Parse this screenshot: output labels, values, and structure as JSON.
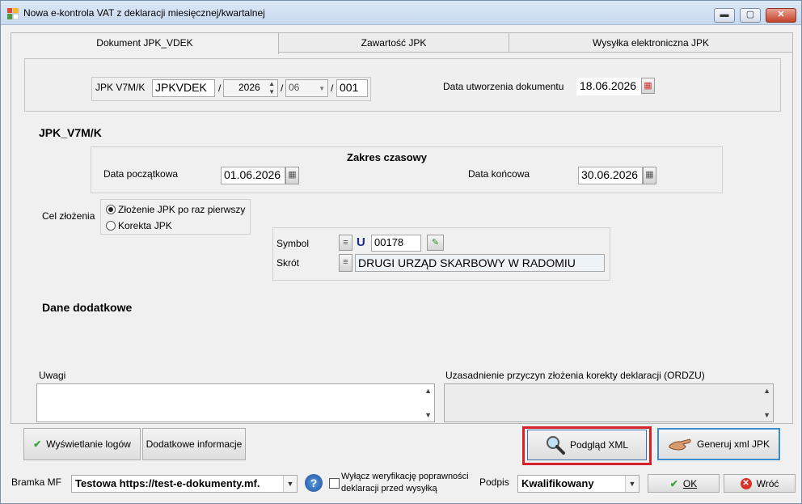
{
  "window": {
    "title": "Nowa e-kontrola VAT z deklaracji miesięcznej/kwartalnej",
    "minimize": "▬",
    "maximize": "▢",
    "close": "✕"
  },
  "tabs": [
    "Dokument JPK_VDEK",
    "Zawartość JPK",
    "Wysyłka elektroniczna JPK"
  ],
  "header": {
    "jpk_label": "JPK V7M/K",
    "jpk_code": "JPKVDEK",
    "sep": "/",
    "year": "2026",
    "month": "06",
    "number": "001",
    "created_label": "Data utworzenia dokumentu",
    "created_date": "18.06.2026"
  },
  "section_title": "JPK_V7M/K",
  "range": {
    "title": "Zakres czasowy",
    "start_label": "Data początkowa",
    "start_date": "01.06.2026",
    "end_label": "Data końcowa",
    "end_date": "30.06.2026"
  },
  "purpose": {
    "label": "Cel złożenia",
    "options": [
      "Złożenie JPK po raz pierwszy",
      "Korekta JPK"
    ],
    "selected": 0
  },
  "office": {
    "symbol_label": "Symbol",
    "u_letter": "U",
    "symbol": "00178",
    "short_label": "Skrót",
    "short": "DRUGI URZĄD SKARBOWY W RADOMIU"
  },
  "extra_title": "Dane dodatkowe",
  "notes_label": "Uwagi",
  "ordzu_label": "Uzasadnienie przyczyn złożenia korekty deklaracji (ORDZU)",
  "buttons": {
    "logs": "Wyświetlanie logów",
    "extra_info": "Dodatkowe informacje",
    "preview": "Podgląd XML",
    "generate": "Generuj xml JPK",
    "ok": "OK",
    "back": "Wróć"
  },
  "footer": {
    "gate_label": "Bramka MF",
    "gate_value": "Testowa https://test-e-dokumenty.mf.",
    "verify_line1": "Wyłącz weryfikację poprawności",
    "verify_line2": "deklaracji przed wysyłką",
    "sign_label": "Podpis",
    "sign_value": "Kwalifikowany"
  },
  "colors": {
    "highlight": "#d6202a",
    "ok_check": "#3aa63a",
    "close_red": "#c3422c",
    "u_blue": "#1a2c8a"
  }
}
